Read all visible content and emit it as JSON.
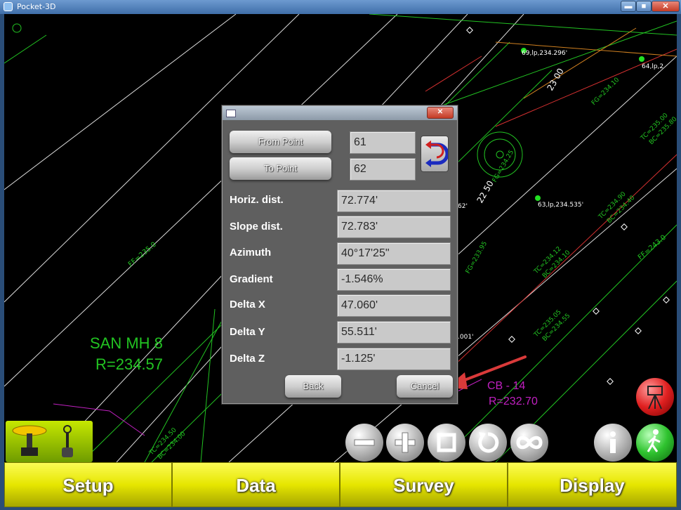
{
  "window": {
    "title": "Pocket-3D",
    "min": "▬",
    "max": "■",
    "close": "✕"
  },
  "dialog": {
    "close": "✕",
    "from_point_label": "From Point",
    "to_point_label": "To Point",
    "from_point_value": "61",
    "to_point_value": "62",
    "fields": [
      {
        "label": "Horiz. dist.",
        "value": "72.774'"
      },
      {
        "label": "Slope dist.",
        "value": "72.783'"
      },
      {
        "label": "Azimuth",
        "value": "40°17'25\""
      },
      {
        "label": "Gradient",
        "value": "-1.546%"
      },
      {
        "label": "Delta X",
        "value": "47.060'"
      },
      {
        "label": "Delta Y",
        "value": "55.511'"
      },
      {
        "label": "Delta Z",
        "value": "-1.125'"
      }
    ],
    "back_label": "Back",
    "cancel_label": "Cancel"
  },
  "map": {
    "san_mh_label": "SAN MH 8",
    "san_mh_elev": "R=234.57",
    "cb_label": "CB -  14",
    "cb_elev": "R=232.70",
    "point_69": "69,lp,234.296'",
    "point_64": "64,lp,2",
    "point_63": "63,lp,234.535'",
    "station_23": "23 00",
    "station_22": "22 50",
    "ff_235": "FF=235.0",
    "ff_243": "FF=243.0",
    "partial_62": "62'",
    "partial_001": ".001'",
    "tc_1": "TC=235.05",
    "bc_1": "BC=234.55",
    "tc_2": "TC=234.50",
    "bc_2": "BC=234.00",
    "tc_3": "TC=234.90",
    "bc_3": "BC=234.40",
    "tc_4": "TC=235.00",
    "bc_4": "BC=235.80",
    "tc_5": "TC=234.12",
    "bc_5": "BC=234.10",
    "fg_1": "FG=234.25",
    "fg_2": "FG=234.10",
    "fg_3": "FG=233.95"
  },
  "menu": {
    "setup": "Setup",
    "data": "Data",
    "survey": "Survey",
    "display": "Display"
  },
  "colors": {
    "accent_yellow": "#e6e600",
    "cad_green": "#22c322",
    "cad_magenta": "#c020c0",
    "arrow_red": "#d93a3a"
  }
}
